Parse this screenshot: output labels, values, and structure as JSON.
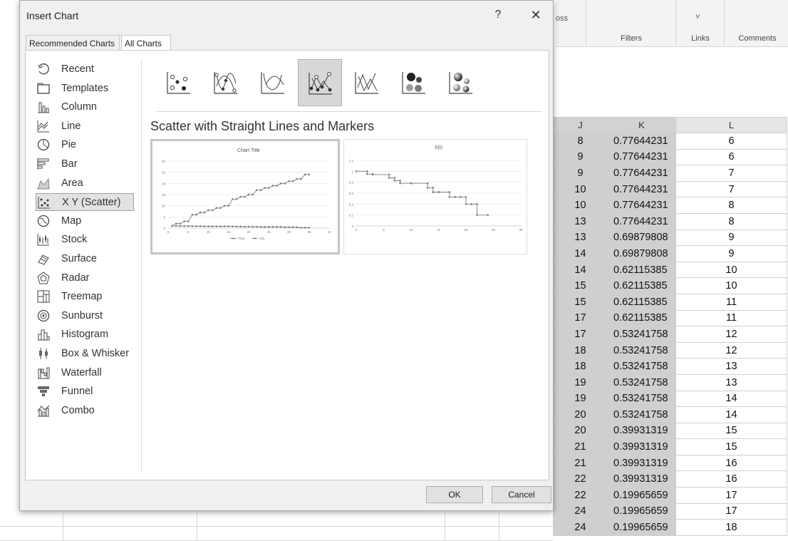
{
  "excel": {
    "ribbon_fragments": {
      "oss": "oss",
      "chevron": "˅"
    },
    "groups": [
      "Filters",
      "Links",
      "Comments"
    ],
    "col_headers": [
      "J",
      "K",
      "L"
    ],
    "rows": [
      [
        "8",
        "0.77644231",
        "6"
      ],
      [
        "9",
        "0.77644231",
        "6"
      ],
      [
        "9",
        "0.77644231",
        "7"
      ],
      [
        "10",
        "0.77644231",
        "7"
      ],
      [
        "10",
        "0.77644231",
        "8"
      ],
      [
        "13",
        "0.77644231",
        "8"
      ],
      [
        "13",
        "0.69879808",
        "9"
      ],
      [
        "14",
        "0.69879808",
        "9"
      ],
      [
        "14",
        "0.62115385",
        "10"
      ],
      [
        "15",
        "0.62115385",
        "10"
      ],
      [
        "15",
        "0.62115385",
        "11"
      ],
      [
        "17",
        "0.62115385",
        "11"
      ],
      [
        "17",
        "0.53241758",
        "12"
      ],
      [
        "18",
        "0.53241758",
        "12"
      ],
      [
        "18",
        "0.53241758",
        "13"
      ],
      [
        "19",
        "0.53241758",
        "13"
      ],
      [
        "19",
        "0.53241758",
        "14"
      ],
      [
        "20",
        "0.53241758",
        "14"
      ],
      [
        "20",
        "0.39931319",
        "15"
      ],
      [
        "21",
        "0.39931319",
        "15"
      ],
      [
        "21",
        "0.39931319",
        "16"
      ],
      [
        "22",
        "0.39931319",
        "16"
      ],
      [
        "22",
        "0.19965659",
        "17"
      ],
      [
        "24",
        "0.19965659",
        "17"
      ],
      [
        "24",
        "0.19965659",
        "18"
      ]
    ]
  },
  "dialog": {
    "title": "Insert Chart",
    "help": "?",
    "close": "✕",
    "tabs": [
      "Recommended Charts",
      "All Charts"
    ],
    "active_tab": "All Charts",
    "categories": [
      {
        "label": "Recent",
        "icon": "recent-icon"
      },
      {
        "label": "Templates",
        "icon": "templates-icon"
      },
      {
        "label": "Column",
        "icon": "column-chart-icon"
      },
      {
        "label": "Line",
        "icon": "line-chart-icon"
      },
      {
        "label": "Pie",
        "icon": "pie-chart-icon"
      },
      {
        "label": "Bar",
        "icon": "bar-chart-icon"
      },
      {
        "label": "Area",
        "icon": "area-chart-icon"
      },
      {
        "label": "X Y (Scatter)",
        "icon": "scatter-chart-icon"
      },
      {
        "label": "Map",
        "icon": "map-chart-icon"
      },
      {
        "label": "Stock",
        "icon": "stock-chart-icon"
      },
      {
        "label": "Surface",
        "icon": "surface-chart-icon"
      },
      {
        "label": "Radar",
        "icon": "radar-chart-icon"
      },
      {
        "label": "Treemap",
        "icon": "treemap-chart-icon"
      },
      {
        "label": "Sunburst",
        "icon": "sunburst-chart-icon"
      },
      {
        "label": "Histogram",
        "icon": "histogram-chart-icon"
      },
      {
        "label": "Box & Whisker",
        "icon": "box-whisker-chart-icon"
      },
      {
        "label": "Waterfall",
        "icon": "waterfall-chart-icon"
      },
      {
        "label": "Funnel",
        "icon": "funnel-chart-icon"
      },
      {
        "label": "Combo",
        "icon": "combo-chart-icon"
      }
    ],
    "selected_category": "X Y (Scatter)",
    "subtypes": [
      "scatter-icon",
      "scatter-smooth-lines-markers-icon",
      "scatter-smooth-lines-icon",
      "scatter-straight-lines-markers-icon",
      "scatter-straight-lines-icon",
      "bubble-icon",
      "3d-bubble-icon"
    ],
    "selected_subtype": "scatter-straight-lines-markers-icon",
    "chart_name": "Scatter with Straight Lines and Markers",
    "ok": "OK",
    "cancel": "Cancel",
    "colors": {
      "series": "#7f7f7f",
      "selected_bg": "#d8d8d8"
    }
  },
  "chart_data": [
    {
      "type": "line",
      "title": "Chart Title",
      "xlim": [
        0,
        40
      ],
      "ylim": [
        0,
        30
      ],
      "xticks": [
        "0",
        "5",
        "10",
        "15",
        "20",
        "25",
        "30",
        "35",
        "40"
      ],
      "yticks": [
        "0",
        "5",
        "10",
        "15",
        "20",
        "25",
        "30"
      ],
      "legend": [
        "Time",
        "S(t)"
      ],
      "legend_position": "bottom",
      "grid": true,
      "series": [
        {
          "name": "Time",
          "x": [
            1,
            2,
            3,
            4,
            5,
            6,
            7,
            8,
            9,
            10,
            11,
            12,
            13,
            14,
            15,
            16,
            17,
            18,
            19,
            20,
            21,
            22,
            23,
            24,
            25,
            26,
            27,
            28,
            29,
            30,
            31,
            32,
            33,
            34,
            35
          ],
          "y": [
            1,
            2,
            2,
            3,
            3,
            6,
            6,
            7,
            7,
            8,
            8,
            9,
            9,
            10,
            10,
            13,
            13,
            14,
            14,
            15,
            15,
            17,
            17,
            18,
            18,
            19,
            19,
            20,
            20,
            21,
            21,
            22,
            22,
            24,
            24
          ]
        },
        {
          "name": "S(t)",
          "x": [
            1,
            2,
            3,
            4,
            5,
            6,
            7,
            8,
            9,
            10,
            11,
            12,
            13,
            14,
            15,
            16,
            17,
            18,
            19,
            20,
            21,
            22,
            23,
            24,
            25,
            26,
            27,
            28,
            29,
            30,
            31,
            32,
            33,
            34,
            35
          ],
          "y": [
            1,
            0.98,
            0.95,
            0.93,
            0.9,
            0.88,
            0.86,
            0.84,
            0.82,
            0.8,
            0.78,
            0.78,
            0.78,
            0.78,
            0.78,
            0.78,
            0.7,
            0.7,
            0.62,
            0.62,
            0.62,
            0.62,
            0.53,
            0.53,
            0.53,
            0.53,
            0.53,
            0.53,
            0.4,
            0.4,
            0.4,
            0.4,
            0.2,
            0.2,
            0.2
          ]
        }
      ]
    },
    {
      "type": "line",
      "title": "S(t)",
      "xlim": [
        0,
        30
      ],
      "ylim": [
        0,
        1.2
      ],
      "xticks": [
        "0",
        "5",
        "10",
        "15",
        "20",
        "25",
        "30"
      ],
      "yticks": [
        "0",
        "0.2",
        "0.4",
        "0.6",
        "0.8",
        "1",
        "1.2"
      ],
      "grid": true,
      "series": [
        {
          "x": [
            0,
            2,
            2,
            3,
            3,
            6,
            6,
            7,
            7,
            8,
            8,
            10,
            10,
            13,
            13,
            14,
            14,
            15,
            15,
            17,
            17,
            18,
            18,
            19,
            19,
            20,
            20,
            21,
            21,
            22,
            22,
            24
          ],
          "y": [
            1,
            1,
            0.95,
            0.95,
            0.94,
            0.94,
            0.88,
            0.88,
            0.83,
            0.83,
            0.78,
            0.78,
            0.78,
            0.78,
            0.7,
            0.7,
            0.62,
            0.62,
            0.62,
            0.62,
            0.53,
            0.53,
            0.53,
            0.53,
            0.53,
            0.53,
            0.4,
            0.4,
            0.4,
            0.4,
            0.2,
            0.2
          ]
        }
      ]
    }
  ]
}
